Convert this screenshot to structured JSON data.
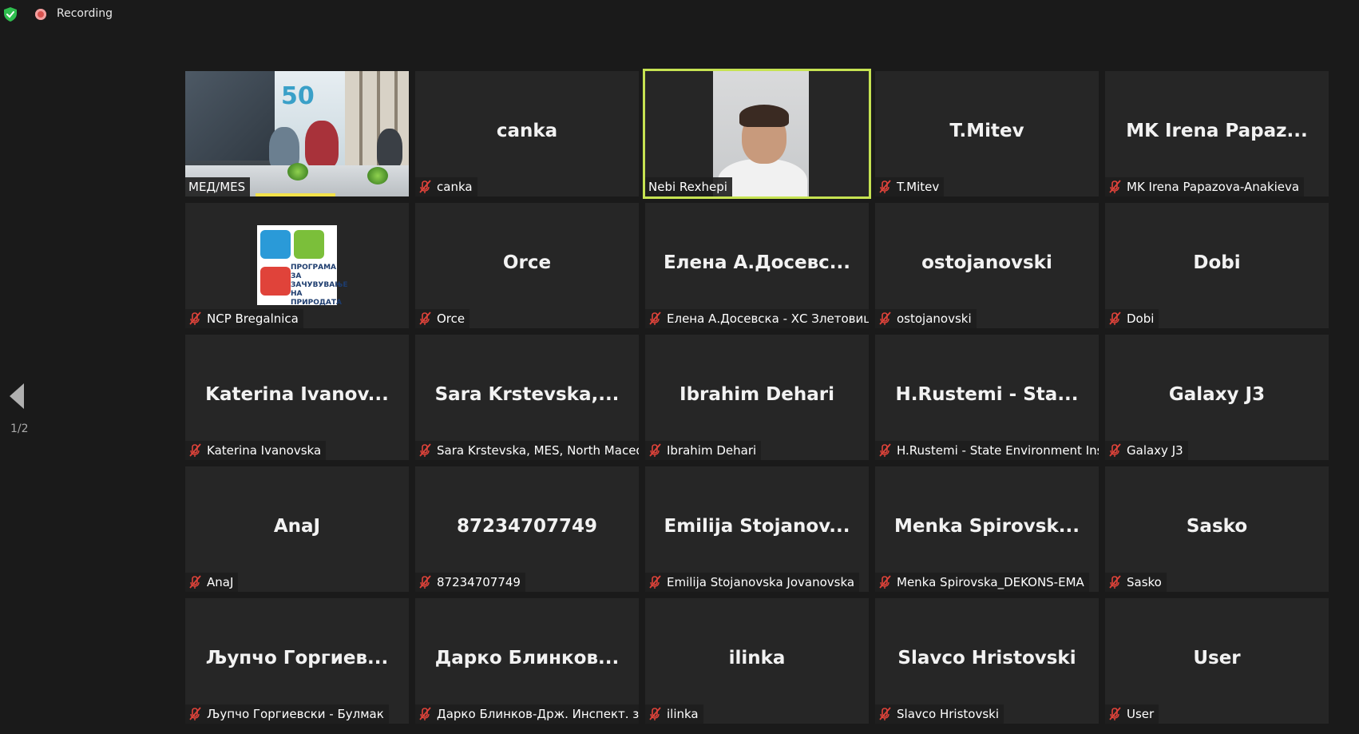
{
  "topbar": {
    "recording_label": "Recording"
  },
  "pager": {
    "page_indicator": "1/2"
  },
  "colors": {
    "active_speaker_border": "#c6e352",
    "muted_mic": "#e0433a",
    "recording": "#d9534f",
    "shield": "#2fbf4f"
  },
  "tiles": [
    {
      "type": "video",
      "label": "МЕД/MES",
      "muted": false
    },
    {
      "type": "name",
      "display": "canka",
      "label": "canka",
      "muted": true
    },
    {
      "type": "video",
      "label": "Nebi Rexhepi",
      "muted": false,
      "active_speaker": true
    },
    {
      "type": "name",
      "display": "T.Mitev",
      "label": "T.Mitev",
      "muted": true
    },
    {
      "type": "name",
      "display": "MK Irena Papaz...",
      "label": "MK Irena Papazova-Anakieva",
      "muted": true
    },
    {
      "type": "image",
      "label": "NCP Bregalnica",
      "muted": true,
      "logo_text": "ПРОГРАМА ЗА ЗАЧУВУВАЊЕ НА ПРИРОДАТА"
    },
    {
      "type": "name",
      "display": "Orce",
      "label": "Orce",
      "muted": true
    },
    {
      "type": "name",
      "display": "Елена  А.Досевс...",
      "label": "Елена А.Досевска - ХС Злетовица",
      "muted": true
    },
    {
      "type": "name",
      "display": "ostojanovski",
      "label": "ostojanovski",
      "muted": true
    },
    {
      "type": "name",
      "display": "Dobi",
      "label": "Dobi",
      "muted": true
    },
    {
      "type": "name",
      "display": "Katerina  Ivanov...",
      "label": "Katerina Ivanovska",
      "muted": true
    },
    {
      "type": "name",
      "display": "Sara  Krstevska,...",
      "label": "Sara Krstevska, MES, North Maced...",
      "muted": true
    },
    {
      "type": "name",
      "display": "Ibrahim Dehari",
      "label": "Ibrahim Dehari",
      "muted": true
    },
    {
      "type": "name",
      "display": "H.Rustemi  -  Sta...",
      "label": "H.Rustemi - State Environment Ins...",
      "muted": true
    },
    {
      "type": "name",
      "display": "Galaxy J3",
      "label": "Galaxy J3",
      "muted": true
    },
    {
      "type": "name",
      "display": "AnaJ",
      "label": "AnaJ",
      "muted": true
    },
    {
      "type": "name",
      "display": "87234707749",
      "label": "87234707749",
      "muted": true
    },
    {
      "type": "name",
      "display": "Emilija  Stojanov...",
      "label": "Emilija Stojanovska Jovanovska",
      "muted": true
    },
    {
      "type": "name",
      "display": "Menka  Spirovsk...",
      "label": "Menka Spirovska_DEKONS-EMA",
      "muted": true
    },
    {
      "type": "name",
      "display": "Sasko",
      "label": "Sasko",
      "muted": true
    },
    {
      "type": "name",
      "display": "Љупчо  Горгиев...",
      "label": "Љупчо Горгиевски - Булмак",
      "muted": true
    },
    {
      "type": "name",
      "display": "Дарко  Блинков...",
      "label": "Дарко Блинков-Држ. Инспект. за...",
      "muted": true
    },
    {
      "type": "name",
      "display": "ilinka",
      "label": "ilinka",
      "muted": true
    },
    {
      "type": "name",
      "display": "Slavco Hristovski",
      "label": "Slavco Hristovski",
      "muted": true
    },
    {
      "type": "name",
      "display": "User",
      "label": "User",
      "muted": true
    }
  ]
}
